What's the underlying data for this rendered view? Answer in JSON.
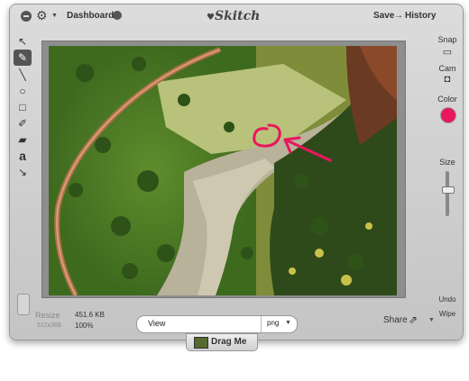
{
  "titlebar": {
    "dashboard_label": "Dashboard",
    "app_name": "Skitch",
    "save_label": "Save",
    "history_label": "History"
  },
  "tools": {
    "items": [
      "pointer",
      "pen",
      "line",
      "ellipse",
      "rectangle",
      "highlighter",
      "eraser",
      "text",
      "arrow"
    ],
    "selected": "pen"
  },
  "right_panel": {
    "snap_label": "Snap",
    "cam_label": "Cam",
    "color_label": "Color",
    "color_value": "#e8175d",
    "size_label": "Size",
    "undo_label": "Undo",
    "wipe_label": "Wipe"
  },
  "bottom": {
    "resize_label": "Resize",
    "dimensions": "512x366",
    "file_size": "451.6 KB",
    "zoom": "100%",
    "filename_value": "View",
    "format_value": "png",
    "share_label": "Share",
    "drag_label": "Drag Me"
  },
  "colors": {
    "annotation": "#e8175d"
  }
}
